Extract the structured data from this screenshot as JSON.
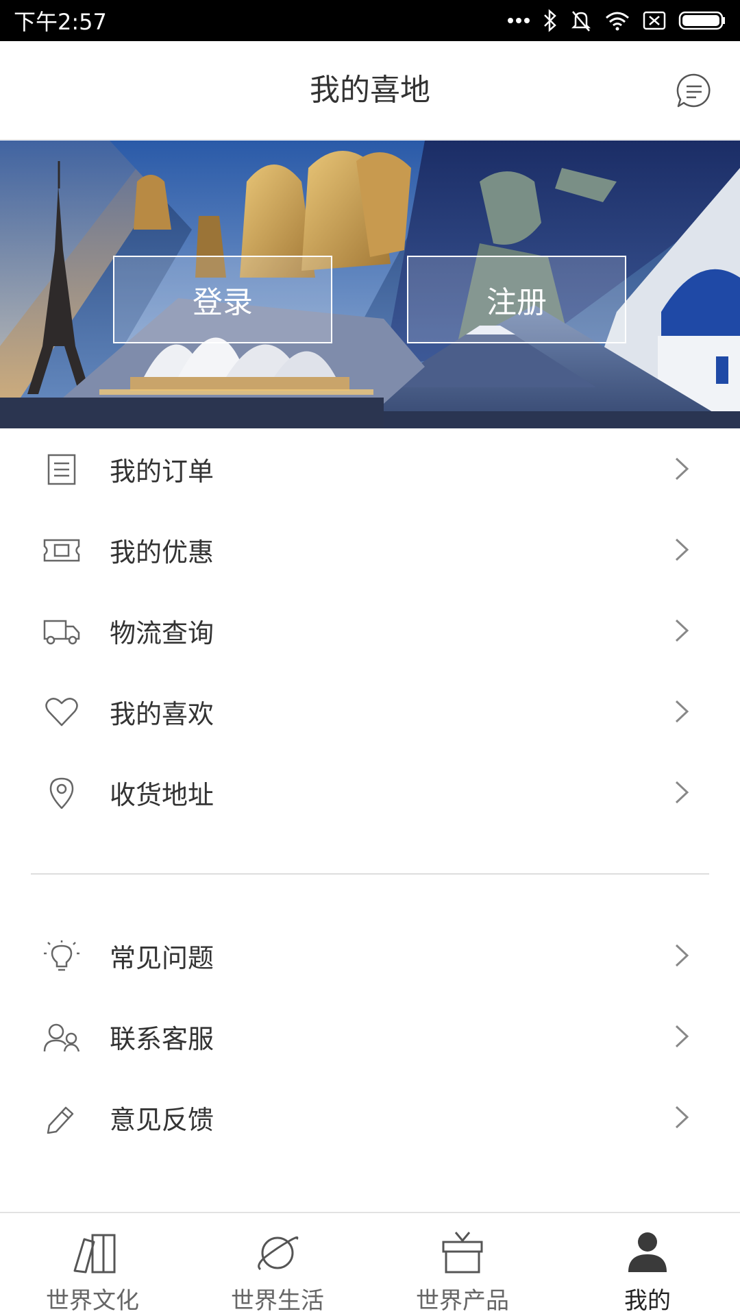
{
  "status_bar": {
    "time": "下午2:57"
  },
  "header": {
    "title": "我的喜地"
  },
  "banner": {
    "login_label": "登录",
    "register_label": "注册"
  },
  "menu_group_1": [
    {
      "label": "我的订单",
      "icon": "order-list-icon"
    },
    {
      "label": "我的优惠",
      "icon": "coupon-icon"
    },
    {
      "label": "物流查询",
      "icon": "truck-icon"
    },
    {
      "label": "我的喜欢",
      "icon": "heart-icon"
    },
    {
      "label": "收货地址",
      "icon": "location-pin-icon"
    }
  ],
  "menu_group_2": [
    {
      "label": "常见问题",
      "icon": "lightbulb-icon"
    },
    {
      "label": "联系客服",
      "icon": "customer-service-icon"
    },
    {
      "label": "意见反馈",
      "icon": "pencil-icon"
    }
  ],
  "bottom_nav": [
    {
      "label": "世界文化",
      "icon": "books-icon",
      "active": false
    },
    {
      "label": "世界生活",
      "icon": "planet-icon",
      "active": false
    },
    {
      "label": "世界产品",
      "icon": "gift-box-icon",
      "active": false
    },
    {
      "label": "我的",
      "icon": "user-icon",
      "active": true
    }
  ],
  "colors": {
    "text": "#333333",
    "divider": "#dddddd",
    "status_bar": "#000000"
  }
}
